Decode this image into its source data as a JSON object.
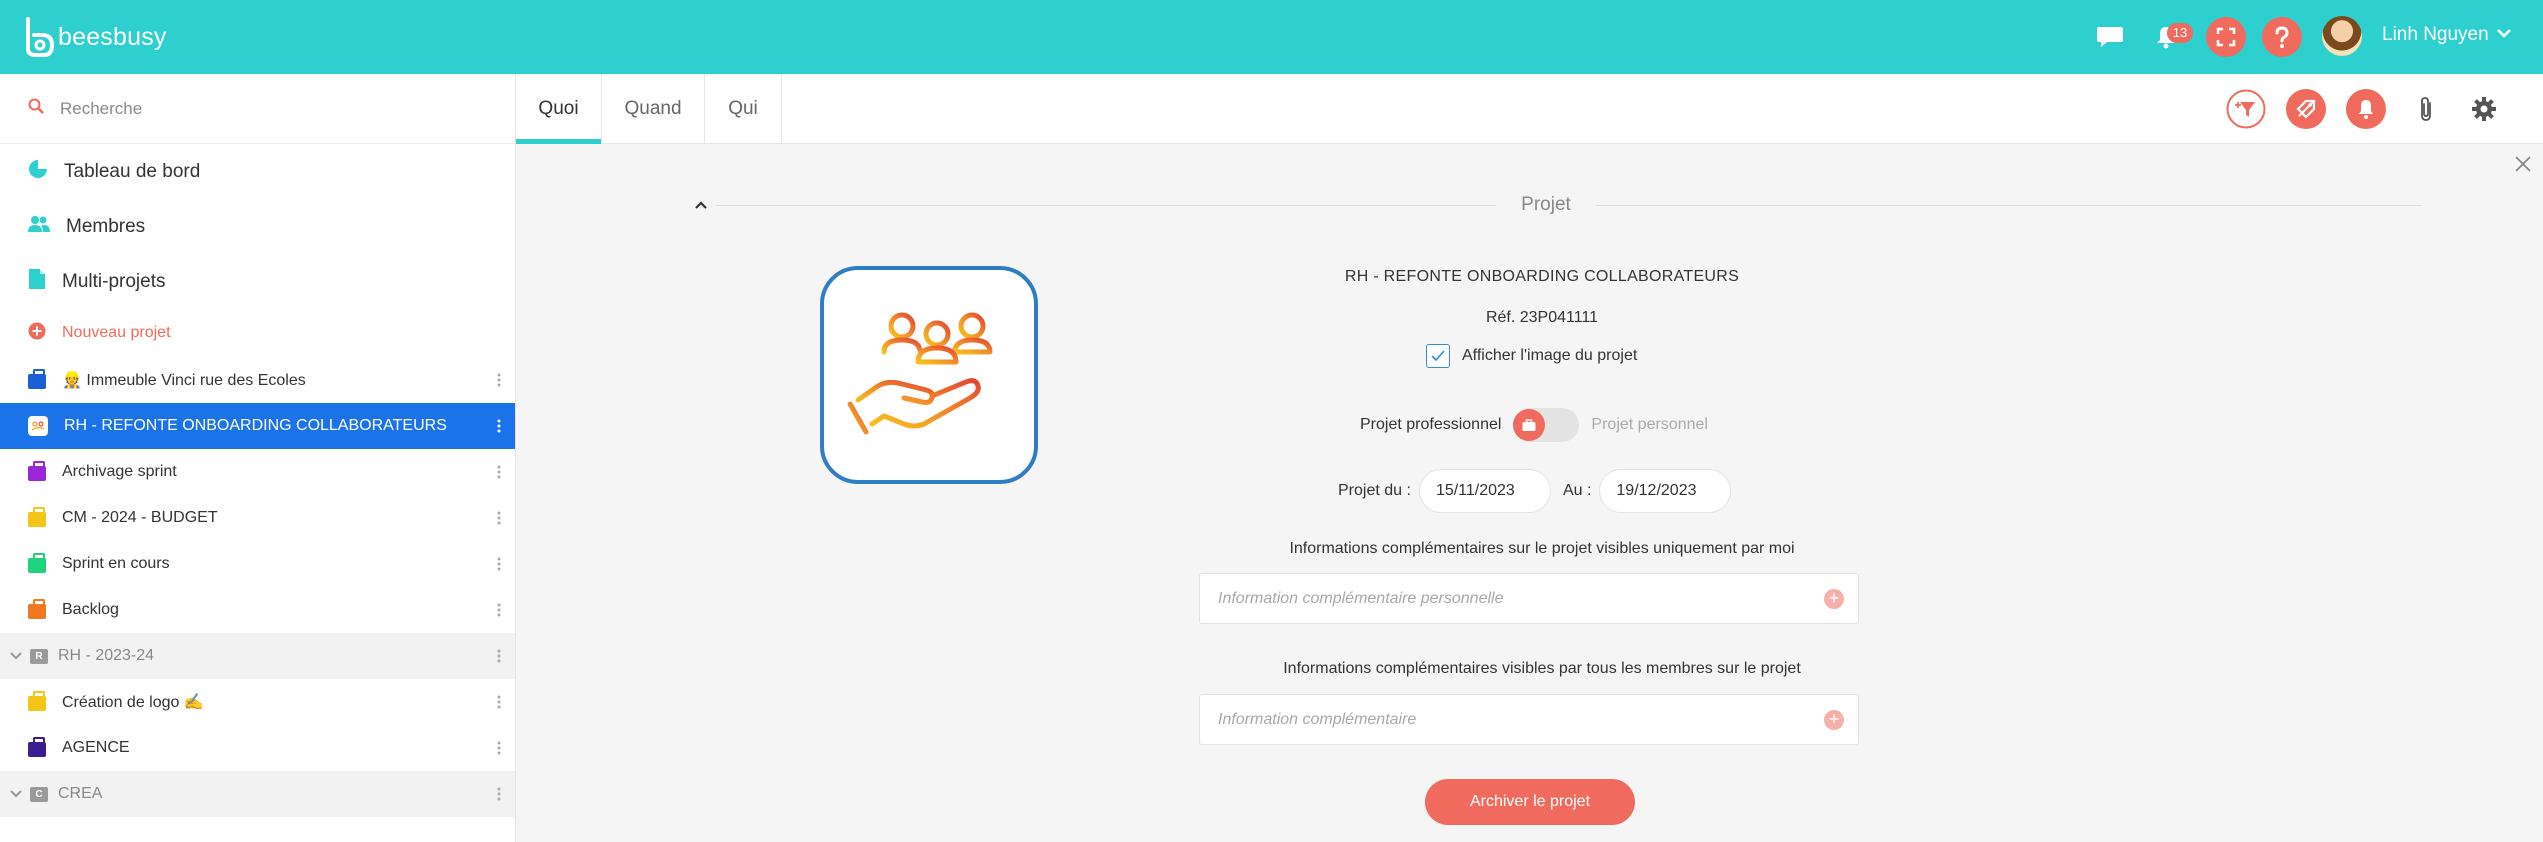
{
  "app": {
    "logo_text": "beesbusy"
  },
  "topbar": {
    "notifications_count": "13",
    "user_name": "Linh Nguyen",
    "icons": [
      "chat-icon",
      "bell-icon",
      "fullscreen-icon",
      "help-icon",
      "chevron-down-icon"
    ]
  },
  "search": {
    "placeholder": "Recherche"
  },
  "sidebar": {
    "nav": [
      {
        "label": "Tableau de bord",
        "icon": "dashboard-icon",
        "color": "#2ecfcf"
      },
      {
        "label": "Membres",
        "icon": "members-icon",
        "color": "#2ecfcf"
      },
      {
        "label": "Multi-projets",
        "icon": "document-icon",
        "color": "#2ecfcf"
      }
    ],
    "new_project_label": "Nouveau projet",
    "projects": [
      {
        "label": "👷 Immeuble Vinci rue des Ecoles",
        "color": "#1a5fd4"
      },
      {
        "label": "RH - REFONTE ONBOARDING COLLABORATEURS",
        "active": true
      },
      {
        "label": "Archivage sprint",
        "color": "#9b27d9"
      },
      {
        "label": "CM - 2024 - BUDGET",
        "color": "#f5c518"
      },
      {
        "label": "Sprint en cours",
        "color": "#1fd37e"
      },
      {
        "label": "Backlog",
        "color": "#f07820"
      },
      {
        "label": "RH - 2023-24",
        "group": true,
        "badge": "R"
      },
      {
        "label": "Création de logo ✍️",
        "color": "#f5c518"
      },
      {
        "label": "AGENCE",
        "color": "#3b1d8f"
      },
      {
        "label": "CREA",
        "group": true,
        "badge": "C"
      }
    ]
  },
  "tabs": [
    {
      "label": "Quoi",
      "active": true
    },
    {
      "label": "Quand"
    },
    {
      "label": "Qui"
    }
  ],
  "toolbar_icons": [
    "add-filter-icon",
    "tag-icon",
    "alert-icon",
    "attachment-icon",
    "settings-icon"
  ],
  "project": {
    "section_title": "Projet",
    "title": "RH - REFONTE ONBOARDING COLLABORATEURS",
    "ref": "Réf. 23P041111",
    "show_image_label": "Afficher l'image du projet",
    "show_image_checked": true,
    "type_professional_label": "Projet professionnel",
    "type_personal_label": "Projet personnel",
    "type_selected": "professionnel",
    "start_label": "Projet du :",
    "start_date": "15/11/2023",
    "end_label": "Au :",
    "end_date": "19/12/2023",
    "private_info_label": "Informations complémentaires sur le projet visibles uniquement par moi",
    "private_info_placeholder": "Information complémentaire personnelle",
    "public_info_label": "Informations complémentaires visibles par tous les membres sur le projet",
    "public_info_placeholder": "Information complémentaire",
    "archive_label": "Archiver le projet"
  },
  "colors": {
    "accent": "#2ecfcf",
    "danger": "#f06b5d",
    "active": "#1a73e8"
  }
}
